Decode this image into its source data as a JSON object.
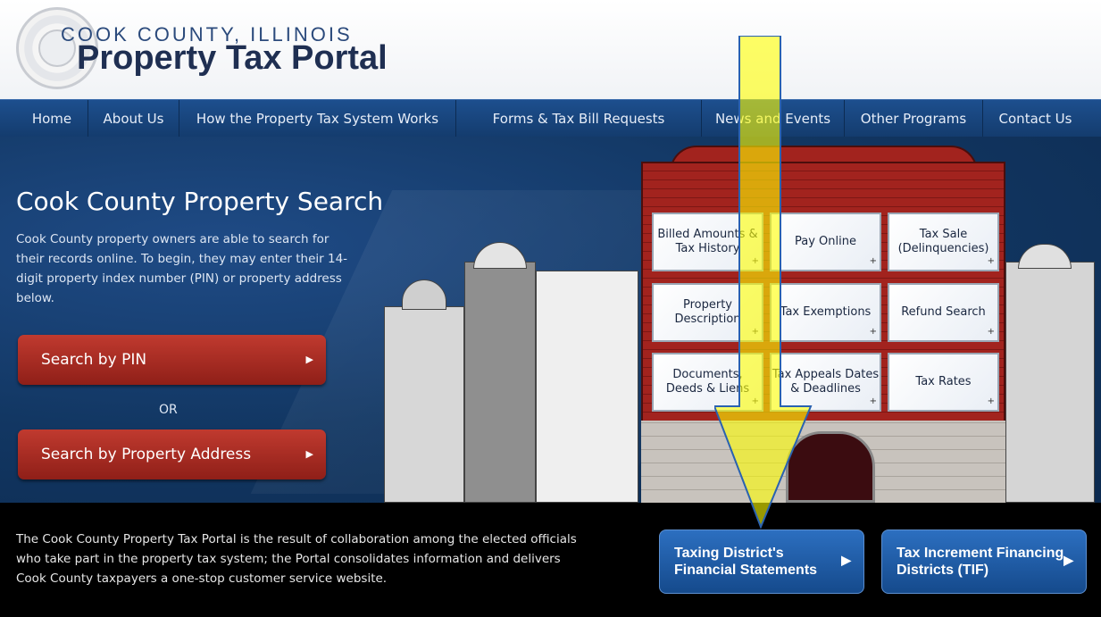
{
  "header": {
    "county": "COOK COUNTY, ILLINOIS",
    "title": "Property Tax Portal"
  },
  "nav": [
    {
      "label": "Home"
    },
    {
      "label": "About Us"
    },
    {
      "label": "How the Property Tax System Works"
    },
    {
      "label": "Forms & Tax Bill Requests"
    },
    {
      "label": "News and Events"
    },
    {
      "label": "Other Programs"
    },
    {
      "label": "Contact Us"
    }
  ],
  "hero": {
    "title": "Cook County Property Search",
    "text": "Cook County property owners are able to search for their records online. To begin, they may enter their 14-digit property index number (PIN) or property address below.",
    "search_pin": "Search by PIN",
    "or": "OR",
    "search_address": "Search by Property Address"
  },
  "tiles": [
    {
      "label": "Billed Amounts & Tax History"
    },
    {
      "label": "Pay Online"
    },
    {
      "label": "Tax Sale (Delinquencies)"
    },
    {
      "label": "Property Description"
    },
    {
      "label": "Tax Exemptions"
    },
    {
      "label": "Refund Search"
    },
    {
      "label": "Documents, Deeds & Liens"
    },
    {
      "label": "Tax Appeals Dates & Deadlines"
    },
    {
      "label": "Tax Rates"
    }
  ],
  "footer": {
    "text": "The Cook County Property Tax Portal is the result of collaboration among the elected officials who take part in the property tax system; the Portal consolidates information and delivers Cook County taxpayers a one-stop customer service website.",
    "btn_taxing": "Taxing District's Financial Statements",
    "btn_tif": "Tax Increment Financing Districts (TIF)"
  },
  "colors": {
    "nav_blue": "#1d4f8e",
    "red_button": "#a8271f",
    "arrow_yellow": "#ffff33"
  }
}
